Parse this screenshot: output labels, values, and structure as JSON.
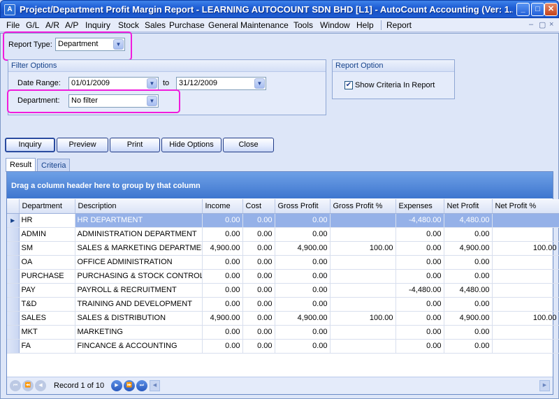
{
  "window": {
    "title": "Project/Department Profit Margin Report - LEARNING AUTOCOUNT SDN BHD [L1] - AutoCount Accounting (Ver: 1...",
    "app_icon_glyph": "A",
    "minimize_glyph": "_",
    "maximize_glyph": "□",
    "close_glyph": "✕"
  },
  "menu": {
    "items": [
      "File",
      "G/L",
      "A/R",
      "A/P",
      "Inquiry",
      "Stock",
      "Sales",
      "Purchase",
      "General Maintenance",
      "Tools",
      "Window",
      "Help",
      "Report"
    ],
    "mdi_minimize": "–",
    "mdi_restore": "▢",
    "mdi_close": "×"
  },
  "report_type": {
    "label": "Report Type:",
    "value": "Department"
  },
  "filter_options": {
    "title": "Filter Options",
    "date_range_label": "Date Range:",
    "date_from": "01/01/2009",
    "to_label": "to",
    "date_to": "31/12/2009",
    "department_label": "Department:",
    "department_value": "No filter"
  },
  "report_option": {
    "title": "Report Option",
    "show_criteria_label": "Show Criteria In Report",
    "show_criteria_checked": true,
    "check_glyph": "✔"
  },
  "buttons": {
    "inquiry": "Inquiry",
    "preview": "Preview",
    "print": "Print",
    "hide_options": "Hide Options",
    "close": "Close"
  },
  "tabs": {
    "result": "Result",
    "criteria": "Criteria"
  },
  "grid": {
    "group_panel_text": "Drag a column header here to group by that column",
    "columns": [
      "Department",
      "Description",
      "Income",
      "Cost",
      "Gross Profit",
      "Gross Profit %",
      "Expenses",
      "Net Profit",
      "Net Profit %"
    ],
    "current_row_glyph": "▶",
    "rows": [
      [
        "HR",
        "HR DEPARTMENT",
        "0.00",
        "0.00",
        "0.00",
        "",
        "-4,480.00",
        "4,480.00",
        ""
      ],
      [
        "ADMIN",
        "ADMINISTRATION DEPARTMENT",
        "0.00",
        "0.00",
        "0.00",
        "",
        "0.00",
        "0.00",
        ""
      ],
      [
        "SM",
        "SALES & MARKETING DEPARTMENT",
        "4,900.00",
        "0.00",
        "4,900.00",
        "100.00",
        "0.00",
        "4,900.00",
        "100.00"
      ],
      [
        "OA",
        "OFFICE ADMINISTRATION",
        "0.00",
        "0.00",
        "0.00",
        "",
        "0.00",
        "0.00",
        ""
      ],
      [
        "PURCHASE",
        "PURCHASING & STOCK CONTROL",
        "0.00",
        "0.00",
        "0.00",
        "",
        "0.00",
        "0.00",
        ""
      ],
      [
        "PAY",
        "PAYROLL & RECRUITMENT",
        "0.00",
        "0.00",
        "0.00",
        "",
        "-4,480.00",
        "4,480.00",
        ""
      ],
      [
        "T&D",
        "TRAINING AND DEVELOPMENT",
        "0.00",
        "0.00",
        "0.00",
        "",
        "0.00",
        "0.00",
        ""
      ],
      [
        "SALES",
        "SALES & DISTRIBUTION",
        "4,900.00",
        "0.00",
        "4,900.00",
        "100.00",
        "0.00",
        "4,900.00",
        "100.00"
      ],
      [
        "MKT",
        "MARKETING",
        "0.00",
        "0.00",
        "0.00",
        "",
        "0.00",
        "0.00",
        ""
      ],
      [
        "FA",
        "FINCANCE & ACCOUNTING",
        "0.00",
        "0.00",
        "0.00",
        "",
        "0.00",
        "0.00",
        ""
      ]
    ]
  },
  "navigator": {
    "record_text": "Record 1 of 10",
    "first_glyph": "⏮",
    "prev_page_glyph": "⏪",
    "prev_glyph": "◀",
    "next_glyph": "▶",
    "next_page_glyph": "⏩",
    "last_glyph": "⏭",
    "scroll_left_glyph": "◀",
    "scroll_right_glyph": "▶"
  },
  "colors": {
    "highlight": "#f01cdc",
    "title_bar": "#1f5fd6",
    "selected_row": "#95b1e8",
    "group_panel": "#3e76cf"
  }
}
